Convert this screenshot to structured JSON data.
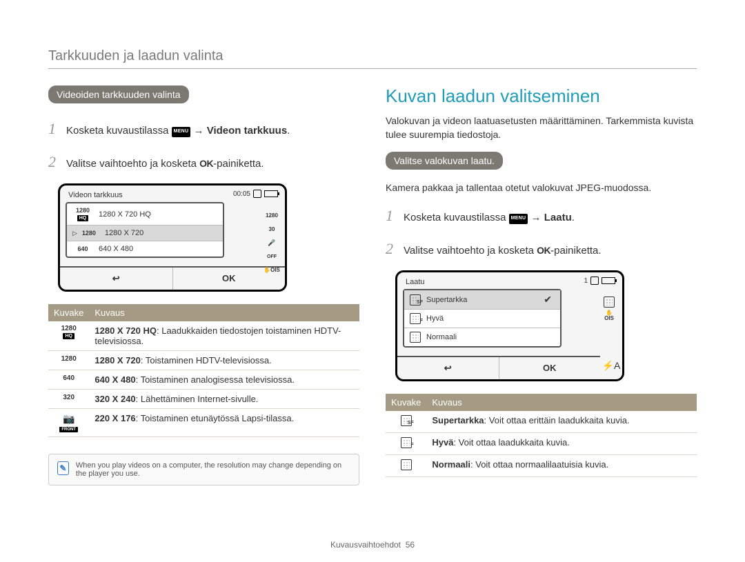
{
  "header": {
    "title": "Tarkkuuden ja laadun valinta"
  },
  "left": {
    "pill": "Videoiden tarkkuuden valinta",
    "steps": {
      "s1_pre": "Kosketa kuvaustilassa ",
      "s1_menu": "MENU",
      "s1_arrow": " → ",
      "s1_bold": "Videon tarkkuus",
      "s1_post": ".",
      "s2_pre": "Valitse vaihtoehto ja kosketa ",
      "s2_ok": "OK",
      "s2_post": "-painiketta."
    },
    "lcd": {
      "title": "Videon tarkkuus",
      "time": "00:05",
      "items": [
        {
          "badge": "1280",
          "sub": "HQ",
          "label": "1280 X 720 HQ"
        },
        {
          "badge": "1280",
          "label": "1280 X 720"
        },
        {
          "badge": "640",
          "label": "640 X 480"
        }
      ],
      "back": "↩",
      "ok": "OK",
      "strip": [
        "1280",
        "30",
        "🎤",
        "OFF",
        "OIS"
      ]
    },
    "table": {
      "h1": "Kuvake",
      "h2": "Kuvaus",
      "rows": [
        {
          "icon": [
            "1280",
            "HQ"
          ],
          "bold": "1280 X 720 HQ",
          "suffix": ": Laadukkaiden tiedostojen toistaminen HDTV-televisiossa."
        },
        {
          "icon": [
            "1280"
          ],
          "bold": "1280 X 720",
          "suffix": ": Toistaminen HDTV-televisiossa."
        },
        {
          "icon": [
            "640"
          ],
          "bold": "640 X 480",
          "suffix": ": Toistaminen analogisessa televisiossa."
        },
        {
          "icon": [
            "320"
          ],
          "bold": "320 X 240",
          "suffix": ": Lähettäminen Internet-sivulle."
        },
        {
          "icon": [
            "FRONT"
          ],
          "bold": "220 X 176",
          "suffix": ": Toistaminen etunäytössä Lapsi-tilassa."
        }
      ]
    },
    "note": "When you play videos on a computer, the resolution may change depending on the player you use."
  },
  "right": {
    "title": "Kuvan laadun valitseminen",
    "intro": "Valokuvan ja videon laatuasetusten määrittäminen. Tarkemmista kuvista tulee suurempia tiedostoja.",
    "pill": "Valitse valokuvan laatu.",
    "intro2": "Kamera pakkaa ja tallentaa otetut valokuvat JPEG-muodossa.",
    "steps": {
      "s1_pre": "Kosketa kuvaustilassa ",
      "s1_menu": "MENU",
      "s1_arrow": " → ",
      "s1_bold": "Laatu",
      "s1_post": ".",
      "s2_pre": "Valitse vaihtoehto ja kosketa ",
      "s2_ok": "OK",
      "s2_post": "-painiketta."
    },
    "lcd": {
      "title": "Laatu",
      "count": "1",
      "items": [
        {
          "sub": "SF",
          "label": "Supertarkka",
          "checked": true
        },
        {
          "sub": "F",
          "label": "Hyvä"
        },
        {
          "sub": "",
          "label": "Normaali"
        }
      ],
      "back": "↩",
      "ok": "OK",
      "flash": "⚡A"
    },
    "table": {
      "h1": "Kuvake",
      "h2": "Kuvaus",
      "rows": [
        {
          "sub": "SF",
          "bold": "Supertarkka",
          "suffix": ": Voit ottaa erittäin laadukkaita kuvia."
        },
        {
          "sub": "F",
          "bold": "Hyvä",
          "suffix": ": Voit ottaa laadukkaita kuvia."
        },
        {
          "sub": "",
          "bold": "Normaali",
          "suffix": ": Voit ottaa normaalilaatuisia kuvia."
        }
      ]
    }
  },
  "footer": {
    "section": "Kuvausvaihtoehdot",
    "page": "56"
  }
}
